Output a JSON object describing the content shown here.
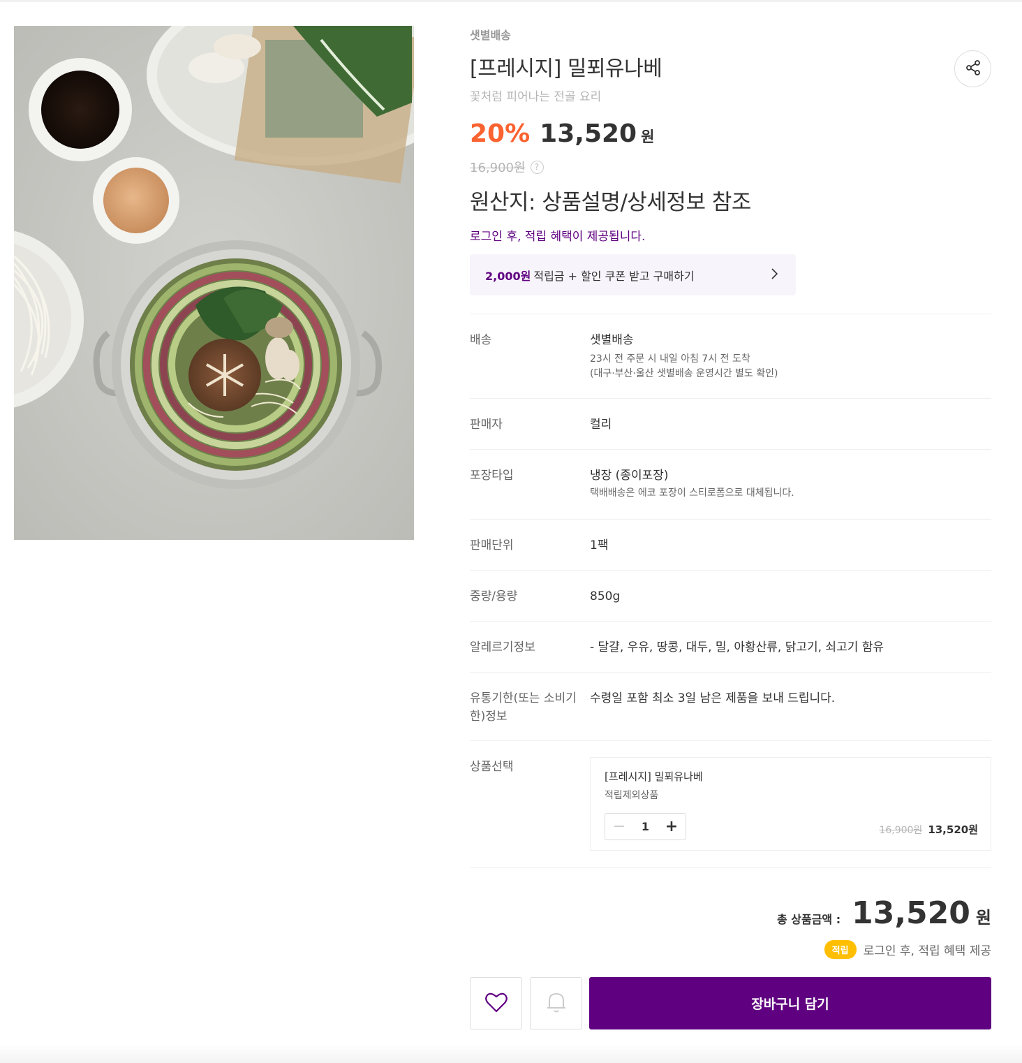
{
  "header": {
    "delivery_tag": "샛별배송",
    "title": "[프레시지] 밀푀유나베",
    "subtitle": "꽃처럼 피어나는 전골 요리"
  },
  "price": {
    "discount": "20%",
    "sale_price": "13,520",
    "won": "원",
    "original_price": "16,900원",
    "help": "?"
  },
  "origin": "원산지: 상품설명/상세정보 참조",
  "login_note": "로그인 후, 적립 혜택이 제공됩니다.",
  "coupon": {
    "amount": "2,000원",
    "text": "적립금 + 할인 쿠폰 받고 구매하기"
  },
  "details": [
    {
      "label": "배송",
      "value": "샛별배송",
      "sub": [
        "23시 전 주문 시 내일 아침 7시 전 도착",
        "(대구·부산·울산 샛별배송 운영시간 별도 확인)"
      ]
    },
    {
      "label": "판매자",
      "value": "컬리",
      "sub": []
    },
    {
      "label": "포장타입",
      "value": "냉장 (종이포장)",
      "sub": [
        "택배배송은 에코 포장이 스티로폼으로 대체됩니다."
      ]
    },
    {
      "label": "판매단위",
      "value": "1팩",
      "sub": []
    },
    {
      "label": "중량/용량",
      "value": "850g",
      "sub": []
    },
    {
      "label": "알레르기정보",
      "value": "- 달걀, 우유, 땅콩, 대두, 밀, 아황산류, 닭고기, 쇠고기 함유",
      "sub": []
    },
    {
      "label": "유통기한(또는 소비기한)정보",
      "value": "수령일 포함 최소 3일 남은 제품을 보내 드립니다.",
      "sub": []
    }
  ],
  "option": {
    "label": "상품선택",
    "name": "[프레시지] 밀푀유나베",
    "sub": "적립제외상품",
    "quantity": "1",
    "original_price": "16,900원",
    "price": "13,520원"
  },
  "total": {
    "label": "총 상품금액 :",
    "price": "13,520",
    "won": "원",
    "reward_badge": "적립",
    "reward_text": "로그인 후, 적립 혜택 제공"
  },
  "actions": {
    "cart": "장바구니 담기",
    "wish_icon": "heart-icon",
    "notify_icon": "bell-icon"
  },
  "colors": {
    "accent": "#5f0080",
    "discount": "#fa622f",
    "badge": "#ffbf00"
  }
}
